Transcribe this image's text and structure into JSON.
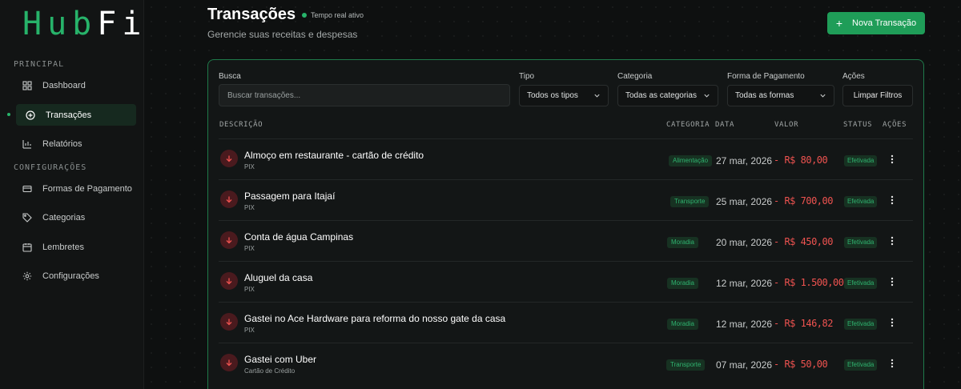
{
  "brand": {
    "left": "Hub",
    "right": "Fi",
    "accent": "#27b36a"
  },
  "sidebar": {
    "sections": [
      "PRINCIPAL",
      "CONFIGURAÇÕES"
    ],
    "items": [
      {
        "label": "Dashboard",
        "icon": "dashboard-icon"
      },
      {
        "label": "Transações",
        "icon": "plus-circle-icon",
        "active": true
      },
      {
        "label": "Relatórios",
        "icon": "bar-chart-icon"
      },
      {
        "label": "Formas de Pagamento",
        "icon": "credit-card-icon"
      },
      {
        "label": "Categorias",
        "icon": "tag-icon"
      },
      {
        "label": "Lembretes",
        "icon": "calendar-icon"
      },
      {
        "label": "Configurações",
        "icon": "gear-icon"
      }
    ]
  },
  "header": {
    "title": "Transações",
    "live_label": "Tempo real ativo",
    "subtitle": "Gerencie suas receitas e despesas",
    "new_button": "Nova Transação"
  },
  "filters": {
    "search_label": "Busca",
    "search_placeholder": "Buscar transações...",
    "type_label": "Tipo",
    "type_value": "Todos os tipos",
    "category_label": "Categoria",
    "category_value": "Todas as categorias",
    "payment_label": "Forma de Pagamento",
    "payment_value": "Todas as formas",
    "actions_label": "Ações",
    "clear_button": "Limpar Filtros"
  },
  "table": {
    "headers": [
      "DESCRIÇÃO",
      "CATEGORIA",
      "DATA",
      "VALOR",
      "STATUS",
      "AÇÕES"
    ],
    "rows": [
      {
        "description": "Almoço em restaurante - cartão de crédito",
        "method": "PIX",
        "category": "Alimentação",
        "date": "27 mar, 2026",
        "value": "- R$ 80,00",
        "status": "Efetivada"
      },
      {
        "description": "Passagem para Itajaí",
        "method": "PIX",
        "category": "Transporte",
        "date": "25 mar, 2026",
        "value": "- R$ 700,00",
        "status": "Efetivada"
      },
      {
        "description": "Conta de água Campinas",
        "method": "PIX",
        "category": "Moradia",
        "date": "20 mar, 2026",
        "value": "- R$ 450,00",
        "status": "Efetivada"
      },
      {
        "description": "Aluguel da casa",
        "method": "PIX",
        "category": "Moradia",
        "date": "12 mar, 2026",
        "value": "- R$ 1.500,00",
        "status": "Efetivada"
      },
      {
        "description": "Gastei no Ace Hardware para reforma do nosso gate da casa",
        "method": "PIX",
        "category": "Moradia",
        "date": "12 mar, 2026",
        "value": "- R$ 146,82",
        "status": "Efetivada"
      },
      {
        "description": "Gastei com Uber",
        "method": "Cartão de Crédito",
        "category": "Transporte",
        "date": "07 mar, 2026",
        "value": "- R$ 50,00",
        "status": "Efetivada"
      }
    ]
  }
}
